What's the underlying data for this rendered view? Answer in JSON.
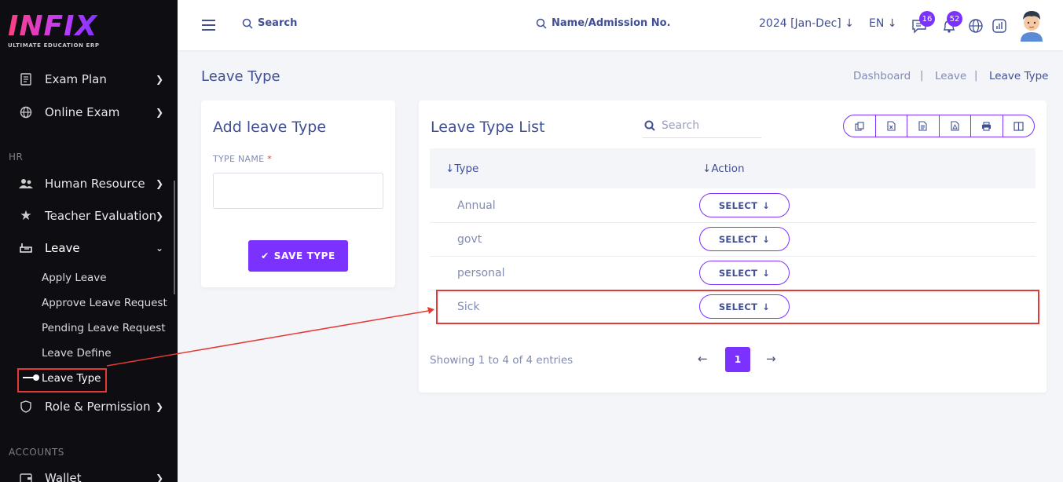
{
  "logo": {
    "main": "INFIX",
    "sub": "ULTIMATE EDUCATION ERP"
  },
  "sidebar": {
    "items_top": [
      {
        "label": "Exam Plan",
        "icon": "document-icon"
      },
      {
        "label": "Online Exam",
        "icon": "globe-icon"
      }
    ],
    "section_hr": "HR",
    "items_hr": [
      {
        "label": "Human Resource",
        "icon": "users-icon"
      },
      {
        "label": "Teacher Evaluation",
        "icon": "star-icon"
      },
      {
        "label": "Leave",
        "icon": "leave-icon"
      }
    ],
    "leave_sub": [
      "Apply Leave",
      "Approve Leave Request",
      "Pending Leave Request",
      "Leave Define",
      "Leave Type"
    ],
    "role_item": {
      "label": "Role & Permission",
      "icon": "shield-icon"
    },
    "section_accounts": "ACCOUNTS",
    "wallet_item": {
      "label": "Wallet",
      "icon": "wallet-icon"
    }
  },
  "header": {
    "search_label": "Search",
    "search2_label": "Name/Admission No.",
    "year": "2024 [Jan-Dec]",
    "lang": "EN",
    "messages_count": "16",
    "notifications_count": "52"
  },
  "page": {
    "title": "Leave Type",
    "breadcrumb": [
      "Dashboard",
      "Leave",
      "Leave Type"
    ]
  },
  "add_form": {
    "title": "Add leave Type",
    "field_label": "TYPE NAME",
    "required_mark": "*",
    "input_value": "",
    "save_label": "SAVE TYPE"
  },
  "list": {
    "title": "Leave Type List",
    "search_placeholder": "Search",
    "columns": [
      "Type",
      "Action"
    ],
    "rows": [
      {
        "type": "Annual",
        "action": "SELECT"
      },
      {
        "type": "govt",
        "action": "SELECT"
      },
      {
        "type": "personal",
        "action": "SELECT"
      },
      {
        "type": "Sick",
        "action": "SELECT"
      }
    ],
    "showing": "Showing 1 to 4 of 4 entries",
    "current_page": "1"
  },
  "colors": {
    "accent": "#7c32ff",
    "text": "#415094",
    "muted": "#828bb2",
    "highlight": "#e53935",
    "sidebar_bg": "#0d0d12"
  }
}
